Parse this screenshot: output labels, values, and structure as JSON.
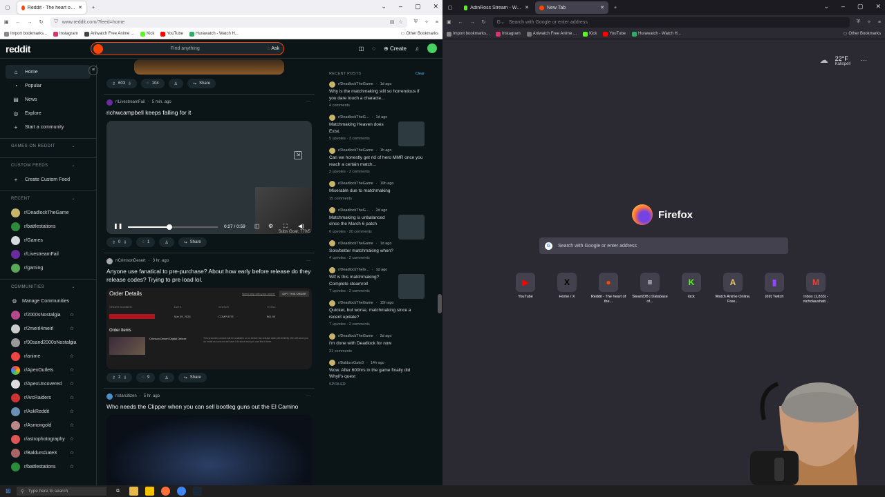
{
  "left_browser": {
    "tabs": [
      {
        "label": "Reddit - The heart of the internet"
      }
    ],
    "url": "www.reddit.com/?feed=home",
    "bookmarks": [
      "Import bookmarks...",
      "Instagram",
      "Aniwatch Free Anime ...",
      "Kick",
      "YouTube",
      "Hurawatch - Watch H..."
    ],
    "other_bookmarks": "Other Bookmarks"
  },
  "right_browser": {
    "tabs": [
      {
        "label": "AdinRoss Stream - Watch Live ..."
      },
      {
        "label": "New Tab"
      }
    ],
    "url_placeholder": "Search with Google or enter address",
    "bookmarks": [
      "Import bookmarks...",
      "Instagram",
      "Aniwatch Free Anime ...",
      "Kick",
      "YouTube",
      "Hurawatch - Watch H..."
    ],
    "other_bookmarks": "Other Bookmarks"
  },
  "reddit": {
    "logo": "reddit",
    "search_placeholder": "Find anything",
    "ask_label": "Ask",
    "create_label": "Create",
    "nav": [
      {
        "label": "Home",
        "icon": "home-icon"
      },
      {
        "label": "Popular",
        "icon": "popular-icon"
      },
      {
        "label": "News",
        "icon": "news-icon"
      },
      {
        "label": "Explore",
        "icon": "explore-icon"
      },
      {
        "label": "Start a community",
        "icon": "plus-icon"
      }
    ],
    "games_section": "GAMES ON REDDIT",
    "custom_feeds_section": "CUSTOM FEEDS",
    "create_custom_feed": "Create Custom Feed",
    "recent_section": "RECENT",
    "recent": [
      "r/DeadlockTheGame",
      "r/battlestations",
      "r/Games",
      "r/LivestreamFail",
      "r/gaming"
    ],
    "communities_section": "COMMUNITIES",
    "manage_communities": "Manage Communities",
    "communities": [
      "r/2000sNostalgia",
      "r/2meirl4meirl",
      "r/90sand2000sNostalgia",
      "r/anime",
      "r/ApexOutlets",
      "r/ApexUncovered",
      "r/ArcRaiders",
      "r/AskReddit",
      "r/Asmongold",
      "r/astrophotography",
      "r/BaldursGate3",
      "r/battlestations"
    ],
    "posts": [
      {
        "votes": "603",
        "comments": "104",
        "share": "Share"
      },
      {
        "subreddit": "r/LivestreamFail",
        "time": "5 min. ago",
        "title": "richwcampbell keeps falling for it",
        "video_time": "0:27 / 0:59",
        "overlay_text": "Subs Goal: 770/5",
        "progress": 0.46,
        "votes": "0",
        "comments": "1",
        "share": "Share"
      },
      {
        "subreddit": "r/CrimsonDesert",
        "time": "3 hr. ago",
        "title": "Anyone use fanatical to pre-purchase? About how early before release do they release codes? Trying to pre load lol.",
        "order_details": "Order Details",
        "order_help": "Need help with your order?",
        "gift_button": "GIFT THIS ORDER",
        "order_columns": [
          "ORDER NUMBER",
          "DATE",
          "STATUS",
          "TOTAL"
        ],
        "order_row": [
          "",
          "Mar 09, 2026",
          "COMPLETE",
          "$61.99"
        ],
        "order_items": "Order Items",
        "item_name": "Crimson Desert Digital Deluxe",
        "item_note": "This preorder product will be available on or before the release date (3/19/2026). We will send you an email as soon as we have it in stock and you can find it here.",
        "votes": "2",
        "comments": "9",
        "share": "Share"
      },
      {
        "subreddit": "r/starcitizen",
        "time": "5 hr. ago",
        "title": "Who needs the Clipper when you can sell bootleg guns out the El Camino"
      }
    ],
    "recent_posts": {
      "heading": "RECENT POSTS",
      "clear": "Clear",
      "items": [
        {
          "sub": "r/DeadlockTheGame",
          "time": "1d ago",
          "title": "Why is the matchmaking still so horrendous if you dare touch a characte...",
          "meta": "4 comments",
          "thumb": false
        },
        {
          "sub": "r/DeadlockTheG...",
          "time": "1d ago",
          "title": "Matchmaking Heaven does Exist.",
          "meta": "5 upvotes · 3 comments",
          "thumb": true
        },
        {
          "sub": "r/DeadlockTheGame",
          "time": "1h ago",
          "title": "Can we honestly get rid of hero MMR once you reach a certain match...",
          "meta": "2 upvotes · 2 comments",
          "thumb": false
        },
        {
          "sub": "r/DeadlockTheGame",
          "time": "19h ago",
          "title": "Miserable due to matchmaking",
          "meta": "15 comments",
          "thumb": false
        },
        {
          "sub": "r/DeadlockTheG...",
          "time": "2d ago",
          "title": "Matchmaking is unbalanced since the March 6 patch",
          "meta": "6 upvotes · 20 comments",
          "thumb": true
        },
        {
          "sub": "r/DeadlockTheGame",
          "time": "1d ago",
          "title": "Solo/better matchmaking when?",
          "meta": "4 upvotes · 2 comments",
          "thumb": false
        },
        {
          "sub": "r/DeadlockTheG...",
          "time": "1d ago",
          "title": "Wtf is this matchmaking? Complete steamroll",
          "meta": "7 upvotes · 2 comments",
          "thumb": true
        },
        {
          "sub": "r/DeadlockTheGame",
          "time": "15h ago",
          "title": "Quicker, but worse, matchmaking since a recent update?",
          "meta": "7 upvotes · 2 comments",
          "thumb": false
        },
        {
          "sub": "r/DeadlockTheGame",
          "time": "3d ago",
          "title": "I'm done with Deadlock for now",
          "meta": "31 comments",
          "thumb": false
        },
        {
          "sub": "r/BaldursGate3",
          "time": "14h ago",
          "title": "Wow. After 600hrs in the game finally did Whyll's quest",
          "meta": "SPOILER",
          "thumb": false
        }
      ]
    }
  },
  "firefox_newtab": {
    "brand": "Firefox",
    "search_placeholder": "Search with Google or enter address",
    "weather_temp": "22°F",
    "weather_city": "Kalispell",
    "shortcuts": [
      {
        "label": "YouTube",
        "glyph": "▶",
        "color": "#ff0000"
      },
      {
        "label": "Home / X",
        "glyph": "X",
        "color": "#000000"
      },
      {
        "label": "Reddit - The heart of the...",
        "glyph": "●",
        "color": "#ff4500"
      },
      {
        "label": "SteamDB | Database of...",
        "glyph": "≡",
        "color": "#ffffff"
      },
      {
        "label": "kick",
        "glyph": "K",
        "color": "#53fc18"
      },
      {
        "label": "Watch Anime Online, Free...",
        "glyph": "A",
        "color": "#e8c36a"
      },
      {
        "label": "(69) Twitch",
        "glyph": "▮",
        "color": "#9146ff"
      },
      {
        "label": "Inbox (1,833) - nicholaushatt...",
        "glyph": "M",
        "color": "#ea4335"
      }
    ]
  },
  "taskbar": {
    "search_placeholder": "Type here to search"
  }
}
